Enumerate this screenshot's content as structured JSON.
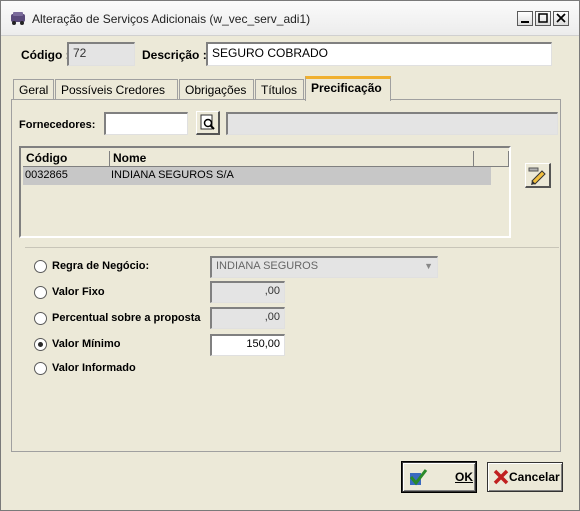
{
  "window": {
    "title": "Alteração de Serviços Adicionais (w_vec_serv_adi1)"
  },
  "header": {
    "codigo_label": "Código :",
    "codigo_value": "72",
    "descricao_label": "Descrição :",
    "descricao_value": "SEGURO COBRADO"
  },
  "tabs": [
    {
      "label": "Geral"
    },
    {
      "label": "Possíveis Credores"
    },
    {
      "label": "Obrigações"
    },
    {
      "label": "Títulos"
    },
    {
      "label": "Precificação",
      "active": true
    }
  ],
  "fornecedores": {
    "label": "Fornecedores:",
    "value": "",
    "name_value": ""
  },
  "grid": {
    "columns": [
      "Código",
      "Nome"
    ],
    "rows": [
      {
        "codigo": "0032865",
        "nome": "INDIANA SEGUROS S/A"
      }
    ]
  },
  "pricing": {
    "regra_label": "Regra de Negócio:",
    "regra_value": "INDIANA SEGUROS",
    "valor_fixo_label": "Valor Fixo",
    "valor_fixo_value": ",00",
    "percentual_label": "Percentual sobre a proposta",
    "percentual_value": ",00",
    "valor_minimo_label": "Valor Mínimo",
    "valor_minimo_value": "150,00",
    "valor_informado_label": "Valor Informado",
    "selected": "Valor Mínimo"
  },
  "buttons": {
    "ok_label": "OK",
    "cancel_label": "Cancelar"
  },
  "colors": {
    "tab_accent": "#f0b030",
    "grid_selected_row": "#c7c7c7",
    "ok_check": "#2a8a2a",
    "cancel_x": "#c02020"
  }
}
